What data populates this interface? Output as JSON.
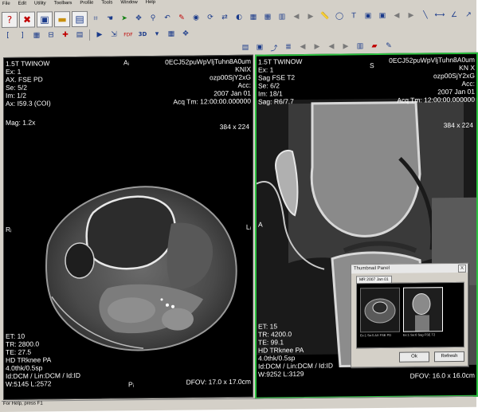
{
  "menu": [
    "File",
    "Edit",
    "Utility",
    "Toolbars",
    "Profile",
    "Tools",
    "Window",
    "Help"
  ],
  "toolbar_icons": {
    "row1": [
      "help-icon",
      "close-icon",
      "image-icon",
      "folder-icon",
      "print-icon",
      "crop-icon",
      "open-hand-icon",
      "pointer-icon",
      "pan-icon",
      "zoom-icon",
      "undo-icon",
      "pencil-icon",
      "capture-icon",
      "rotate-icon",
      "flip-icon",
      "contrast-icon",
      "grid-icon",
      "grid-icon",
      "layout-icon",
      "arrow-left-icon",
      "arrow-right-icon",
      "ruler-icon",
      "ellipse-icon",
      "text-icon",
      "image-icon",
      "image-icon",
      "arrow-left-icon",
      "arrow-right-icon",
      "line-icon",
      "measure-icon",
      "angle-icon",
      "arrow-icon",
      "close-icon",
      "scroll-icon"
    ],
    "row2": [
      "left-bracket-icon",
      "right-bracket-icon",
      "grid-icon",
      "bounding-icon",
      "crosshair-icon",
      "layout-icon",
      "cine-icon",
      "pointer-icon",
      "pdf-icon",
      "3d-icon",
      "filter-icon",
      "grid-icon",
      "pan-icon"
    ],
    "row3": [
      "print-icon",
      "save-icon",
      "export-icon",
      "stack-icon",
      "arrow-left-icon",
      "arrow-right-icon",
      "arrow-left-icon",
      "arrow-right-icon",
      "layout-icon",
      "book-icon",
      "ruler-icon"
    ]
  },
  "labels_3d": {
    "pdf": "FDF",
    "three_d": "3D"
  },
  "viewer_left": {
    "top_left": [
      "1.5T TWINOW",
      "Ex: 1",
      "AX. FSE PD",
      "Se: 5/2",
      "Im: 1/2",
      "Ax: I59.3 (COI)"
    ],
    "mag": "Mag: 1.2x",
    "top_center": "Aᵢ",
    "top_right": [
      "0ECJ52puWpVljTuhn8A0um",
      "KNIX",
      "ozp00SjY2xG",
      "Acc:",
      "2007 Jan 01",
      "Acq Tm: 12:00:00.000000"
    ],
    "matrix": "384 x 224",
    "left_marker": "Rᵢ",
    "right_marker": "Lᵢ",
    "bottom_left": [
      "ET: 10",
      "TR: 2800.0",
      "TE: 27.5",
      "HD TRknee PA",
      "4.0thk/0.5sp",
      "Id:DCM / Lin:DCM / Id:ID",
      "W:5145  L:2572"
    ],
    "bottom_center": "Pᵢ",
    "bottom_right": "DFOV: 17.0 x 17.0cm"
  },
  "viewer_right": {
    "top_left": [
      "1.5T TWINOW",
      "Ex: 1",
      "Sag FSE T2",
      "Se: 6/2",
      "Im: 18/1",
      "Sag: R6/7.7"
    ],
    "top_center": "S",
    "top_right": [
      "0ECJ52puWpVljTuhn8A0um",
      "KN X",
      "ozp00SjY2xG",
      "Acc:",
      "2007 Jan 01",
      "Acq Tm: 12:00:00.000000"
    ],
    "matrix": "384 x 224",
    "left_marker": "A",
    "bottom_left": [
      "ET: 15",
      "TR: 4200.0",
      "TE: 99.1",
      "HD TRknee PA",
      "4.0thk/0.5sp",
      "Id:DCM / Lin:DCM / Id:ID",
      "W:9252  L:3129"
    ],
    "bottom_right": "DFOV: 16.0 x 16.0cm"
  },
  "dialog": {
    "title": "Thumbnail Panel",
    "close": "X",
    "tab": "MR 2007 Jan 01",
    "thumbs": [
      "Ex:1 Se:5 AX FSE PD",
      "Ex:1 Se:6 Sag FSE T2"
    ],
    "ok": "Ok",
    "refresh": "Refresh"
  },
  "status": "For Help, press F1"
}
